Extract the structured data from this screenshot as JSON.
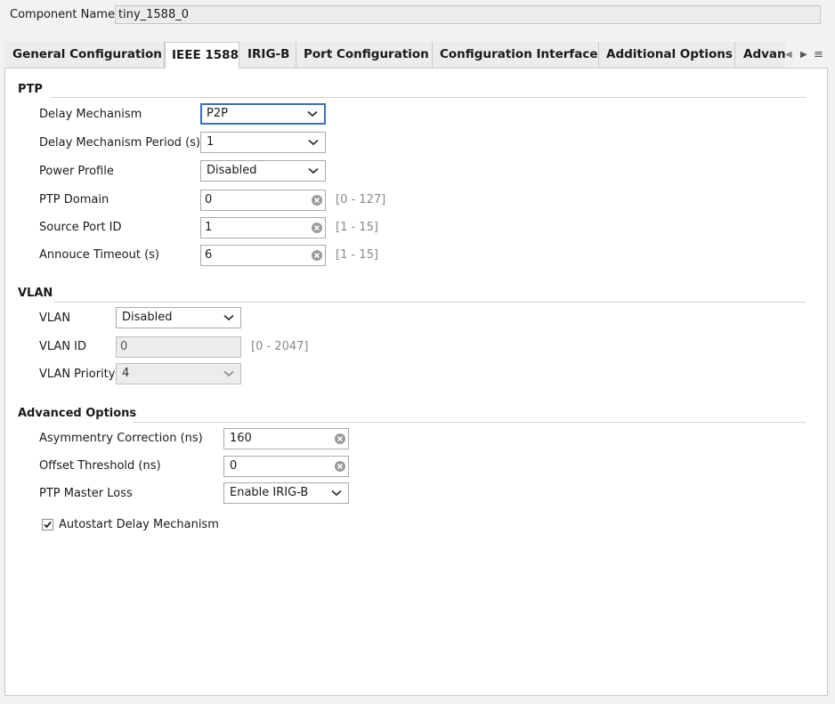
{
  "component": {
    "label": "Component Name",
    "value": "tiny_1588_0"
  },
  "tabs": [
    {
      "label": "General Configuration"
    },
    {
      "label": "IEEE 1588",
      "active": true
    },
    {
      "label": "IRIG-B"
    },
    {
      "label": "Port Configuration"
    },
    {
      "label": "Configuration Interface"
    },
    {
      "label": "Additional Options"
    },
    {
      "label": "Advan"
    }
  ],
  "ptp": {
    "title": "PTP",
    "delay_mechanism": {
      "label": "Delay Mechanism",
      "value": "P2P"
    },
    "delay_period": {
      "label": "Delay Mechanism Period (s)",
      "value": "1"
    },
    "power_profile": {
      "label": "Power Profile",
      "value": "Disabled"
    },
    "domain": {
      "label": "PTP Domain",
      "value": "0",
      "range": "[0 - 127]"
    },
    "source_port": {
      "label": "Source Port ID",
      "value": "1",
      "range": "[1 - 15]"
    },
    "announce_timeout": {
      "label": "Annouce Timeout (s)",
      "value": "6",
      "range": "[1 - 15]"
    }
  },
  "vlan": {
    "title": "VLAN",
    "vlan": {
      "label": "VLAN",
      "value": "Disabled"
    },
    "vlan_id": {
      "label": "VLAN ID",
      "value": "0",
      "range": "[0 - 2047]"
    },
    "priority": {
      "label": "VLAN Priority",
      "value": "4"
    }
  },
  "advanced": {
    "title": "Advanced Options",
    "asymmetry": {
      "label": "Asymmentry Correction (ns)",
      "value": "160"
    },
    "offset": {
      "label": "Offset Threshold (ns)",
      "value": "0"
    },
    "master_loss": {
      "label": "PTP Master Loss",
      "value": "Enable IRIG-B"
    },
    "autostart": {
      "label": "Autostart Delay Mechanism",
      "checked": true
    }
  },
  "icons": {
    "tab_left": "triangle-left-icon",
    "tab_right": "triangle-right-icon",
    "tab_menu": "menu-icon",
    "dropdown": "chevron-down-icon",
    "clear": "clear-circle-icon",
    "check": "checkmark-icon"
  },
  "colors": {
    "focus": "#3c6fb7",
    "panel": "#ffffff",
    "background": "#f2f2f2"
  }
}
